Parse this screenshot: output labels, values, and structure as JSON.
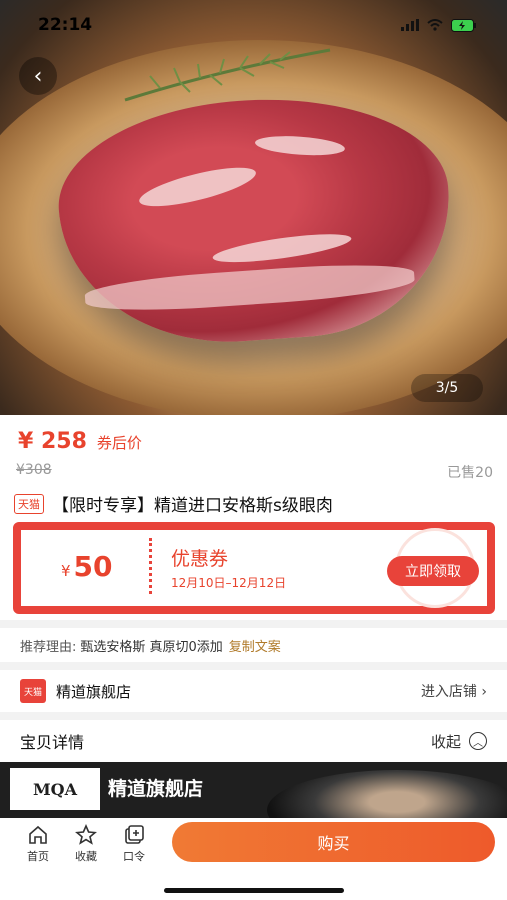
{
  "status_bar": {
    "time": "22:14"
  },
  "hero": {
    "counter": "3/5",
    "back_icon": "chevron-left-icon"
  },
  "price": {
    "current": "¥ 258",
    "label": "券后价",
    "original": "¥308",
    "sold": "已售20"
  },
  "product": {
    "badge": "天猫",
    "title": "【限时专享】精道进口安格斯s级眼肉"
  },
  "coupon": {
    "currency": "¥",
    "amount": "50",
    "title": "优惠券",
    "date_range": "12月10日–12月12日",
    "button": "立即领取"
  },
  "recommend": {
    "label": "推荐理由:",
    "text": "甄选安格斯  真原切0添加",
    "copy": "复制文案"
  },
  "store": {
    "logo": "天猫",
    "name": "精道旗舰店",
    "link": "进入店铺 ›"
  },
  "details": {
    "title": "宝贝详情",
    "collapse": "收起"
  },
  "banner": {
    "logo": "MQA",
    "text": "精道旗舰店"
  },
  "bottom_bar": {
    "tabs": [
      {
        "label": "首页",
        "icon": "home-icon"
      },
      {
        "label": "收藏",
        "icon": "star-icon"
      },
      {
        "label": "口令",
        "icon": "password-icon"
      }
    ],
    "buy": "购买"
  },
  "colors": {
    "accent": "#e8433a",
    "buy": "#ee5a2b",
    "copy_link": "#b07a2a"
  }
}
